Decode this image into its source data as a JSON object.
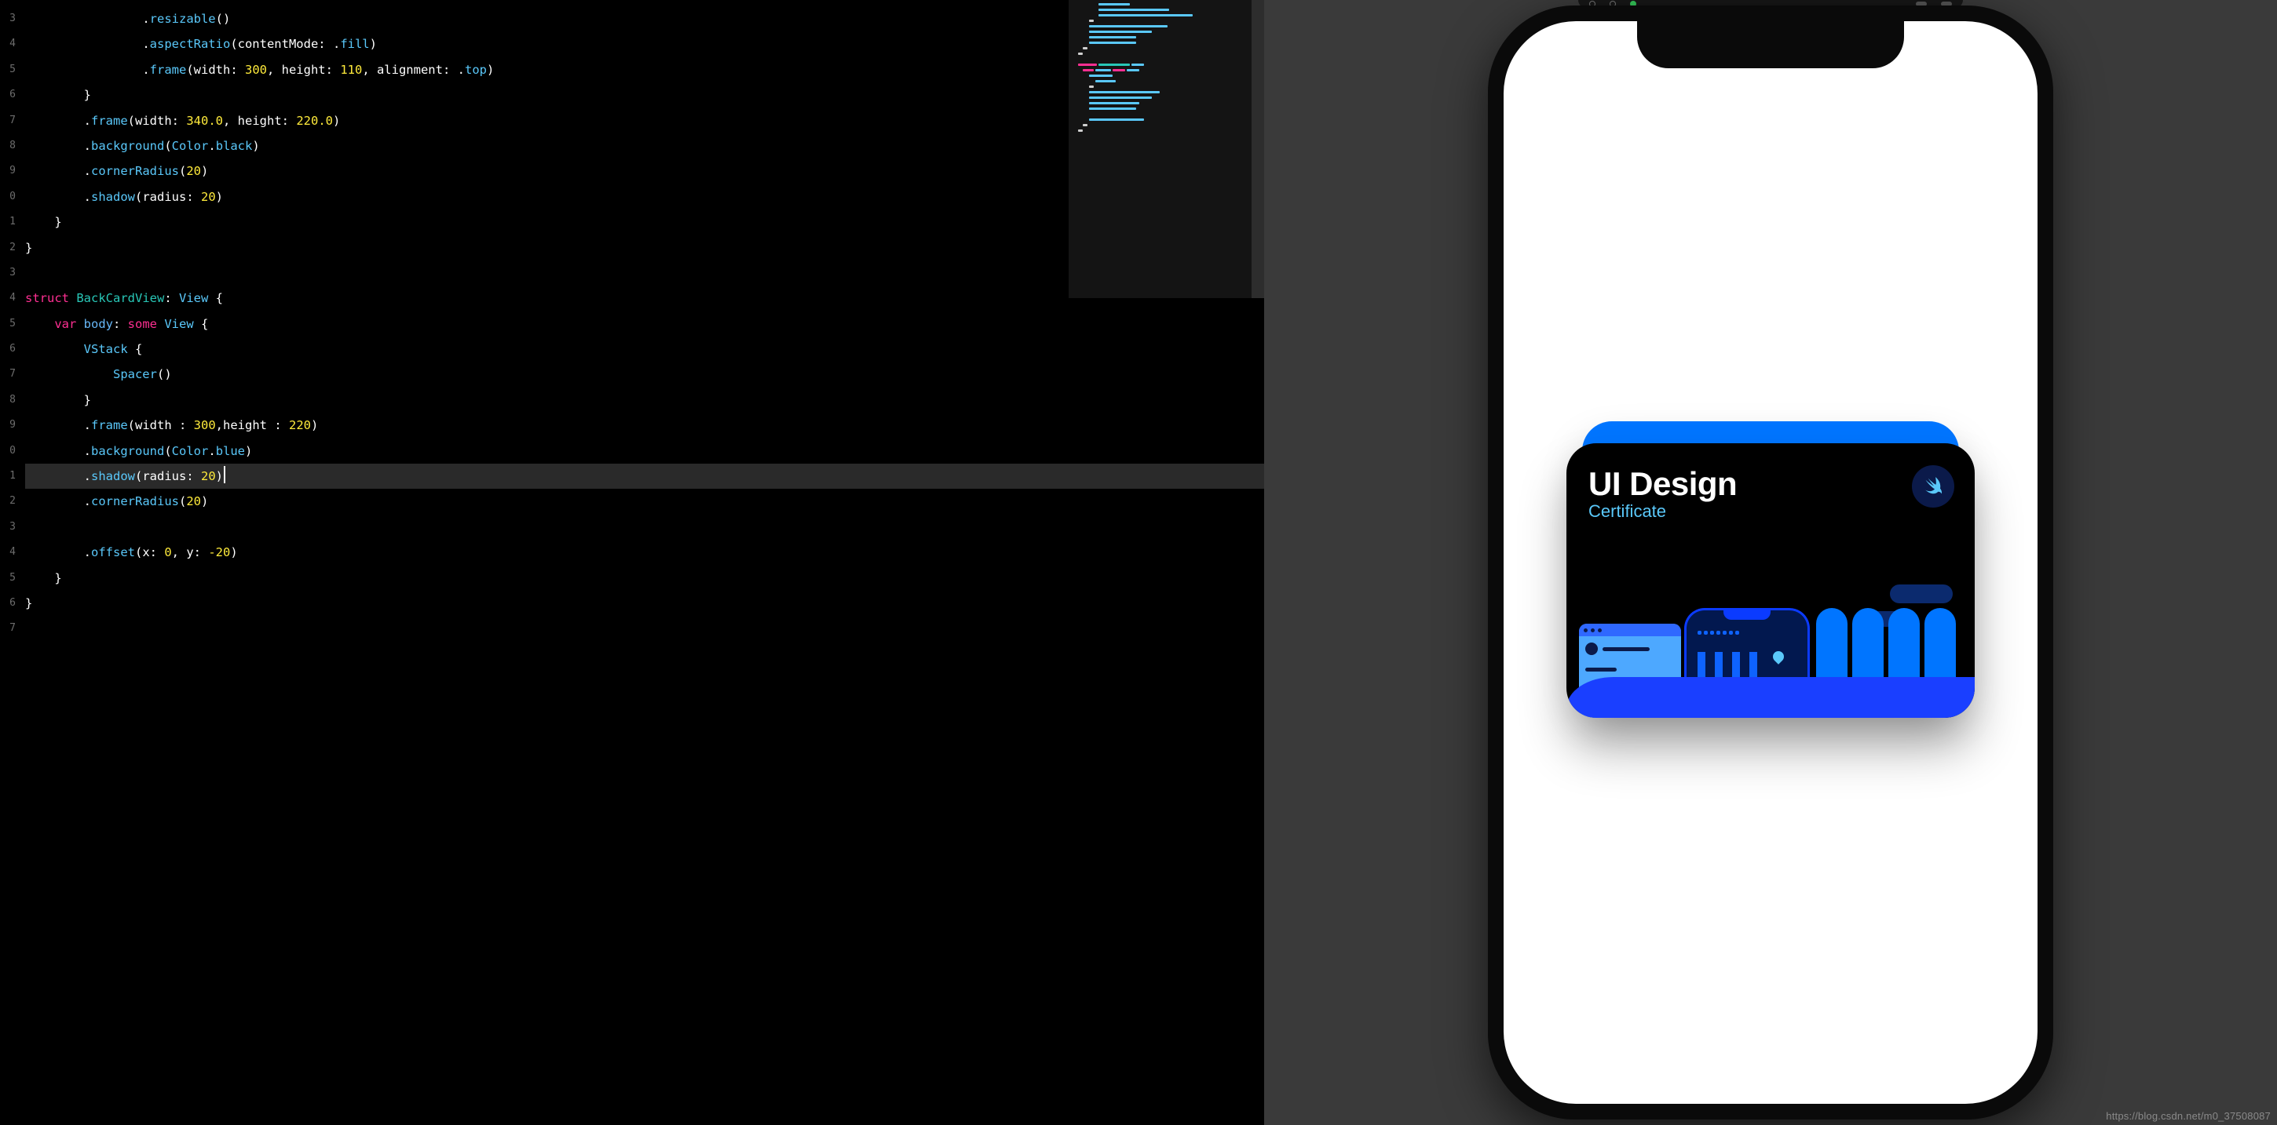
{
  "editor": {
    "gutter": [
      "3",
      "4",
      "5",
      "6",
      "7",
      "8",
      "9",
      "0",
      "1",
      "2",
      "3",
      "4",
      "5",
      "6",
      "7",
      "8",
      "9",
      "0",
      "1",
      "2",
      "3",
      "4",
      "5",
      "6",
      "7"
    ],
    "highlighted_line_index": 18,
    "cursor_line_index": 18,
    "lines": [
      {
        "indent": 16,
        "tokens": [
          {
            "t": ".",
            "c": "dot"
          },
          {
            "t": "resizable",
            "c": "func"
          },
          {
            "t": "()",
            "c": "plain"
          }
        ]
      },
      {
        "indent": 16,
        "tokens": [
          {
            "t": ".",
            "c": "dot"
          },
          {
            "t": "aspectRatio",
            "c": "func"
          },
          {
            "t": "(contentMode: ",
            "c": "plain"
          },
          {
            "t": ".",
            "c": "dot"
          },
          {
            "t": "fill",
            "c": "func"
          },
          {
            "t": ")",
            "c": "plain"
          }
        ]
      },
      {
        "indent": 16,
        "tokens": [
          {
            "t": ".",
            "c": "dot"
          },
          {
            "t": "frame",
            "c": "func"
          },
          {
            "t": "(width: ",
            "c": "plain"
          },
          {
            "t": "300",
            "c": "num"
          },
          {
            "t": ", height: ",
            "c": "plain"
          },
          {
            "t": "110",
            "c": "num"
          },
          {
            "t": ", alignment: ",
            "c": "plain"
          },
          {
            "t": ".",
            "c": "dot"
          },
          {
            "t": "top",
            "c": "func"
          },
          {
            "t": ")",
            "c": "plain"
          }
        ]
      },
      {
        "indent": 8,
        "tokens": [
          {
            "t": "}",
            "c": "plain"
          }
        ]
      },
      {
        "indent": 8,
        "tokens": [
          {
            "t": ".",
            "c": "dot"
          },
          {
            "t": "frame",
            "c": "func"
          },
          {
            "t": "(width: ",
            "c": "plain"
          },
          {
            "t": "340.0",
            "c": "num"
          },
          {
            "t": ", height: ",
            "c": "plain"
          },
          {
            "t": "220.0",
            "c": "num"
          },
          {
            "t": ")",
            "c": "plain"
          }
        ]
      },
      {
        "indent": 8,
        "tokens": [
          {
            "t": ".",
            "c": "dot"
          },
          {
            "t": "background",
            "c": "func"
          },
          {
            "t": "(",
            "c": "plain"
          },
          {
            "t": "Color",
            "c": "type"
          },
          {
            "t": ".",
            "c": "dot"
          },
          {
            "t": "black",
            "c": "func"
          },
          {
            "t": ")",
            "c": "plain"
          }
        ]
      },
      {
        "indent": 8,
        "tokens": [
          {
            "t": ".",
            "c": "dot"
          },
          {
            "t": "cornerRadius",
            "c": "func"
          },
          {
            "t": "(",
            "c": "plain"
          },
          {
            "t": "20",
            "c": "num"
          },
          {
            "t": ")",
            "c": "plain"
          }
        ]
      },
      {
        "indent": 8,
        "tokens": [
          {
            "t": ".",
            "c": "dot"
          },
          {
            "t": "shadow",
            "c": "func"
          },
          {
            "t": "(radius: ",
            "c": "plain"
          },
          {
            "t": "20",
            "c": "num"
          },
          {
            "t": ")",
            "c": "plain"
          }
        ]
      },
      {
        "indent": 4,
        "tokens": [
          {
            "t": "}",
            "c": "plain"
          }
        ]
      },
      {
        "indent": 0,
        "tokens": [
          {
            "t": "}",
            "c": "plain"
          }
        ]
      },
      {
        "indent": 0,
        "tokens": []
      },
      {
        "indent": 0,
        "tokens": [
          {
            "t": "struct ",
            "c": "kw"
          },
          {
            "t": "BackCardView",
            "c": "name"
          },
          {
            "t": ": ",
            "c": "plain"
          },
          {
            "t": "View",
            "c": "type"
          },
          {
            "t": " {",
            "c": "plain"
          }
        ]
      },
      {
        "indent": 4,
        "tokens": [
          {
            "t": "var ",
            "c": "kw"
          },
          {
            "t": "body",
            "c": "param"
          },
          {
            "t": ": ",
            "c": "plain"
          },
          {
            "t": "some ",
            "c": "kw"
          },
          {
            "t": "View",
            "c": "type"
          },
          {
            "t": " {",
            "c": "plain"
          }
        ]
      },
      {
        "indent": 8,
        "tokens": [
          {
            "t": "VStack",
            "c": "type"
          },
          {
            "t": " {",
            "c": "plain"
          }
        ]
      },
      {
        "indent": 12,
        "tokens": [
          {
            "t": "Spacer",
            "c": "type"
          },
          {
            "t": "()",
            "c": "plain"
          }
        ]
      },
      {
        "indent": 8,
        "tokens": [
          {
            "t": "}",
            "c": "plain"
          }
        ]
      },
      {
        "indent": 8,
        "tokens": [
          {
            "t": ".",
            "c": "dot"
          },
          {
            "t": "frame",
            "c": "func"
          },
          {
            "t": "(width : ",
            "c": "plain"
          },
          {
            "t": "300",
            "c": "num"
          },
          {
            "t": ",height : ",
            "c": "plain"
          },
          {
            "t": "220",
            "c": "num"
          },
          {
            "t": ")",
            "c": "plain"
          }
        ]
      },
      {
        "indent": 8,
        "tokens": [
          {
            "t": ".",
            "c": "dot"
          },
          {
            "t": "background",
            "c": "func"
          },
          {
            "t": "(",
            "c": "plain"
          },
          {
            "t": "Color",
            "c": "type"
          },
          {
            "t": ".",
            "c": "dot"
          },
          {
            "t": "blue",
            "c": "func"
          },
          {
            "t": ")",
            "c": "plain"
          }
        ]
      },
      {
        "indent": 8,
        "tokens": [
          {
            "t": ".",
            "c": "dot"
          },
          {
            "t": "shadow",
            "c": "func"
          },
          {
            "t": "(radius: ",
            "c": "plain"
          },
          {
            "t": "20",
            "c": "num"
          },
          {
            "t": ")",
            "c": "plain"
          }
        ]
      },
      {
        "indent": 8,
        "tokens": [
          {
            "t": ".",
            "c": "dot"
          },
          {
            "t": "cornerRadius",
            "c": "func"
          },
          {
            "t": "(",
            "c": "plain"
          },
          {
            "t": "20",
            "c": "num"
          },
          {
            "t": ")",
            "c": "plain"
          }
        ]
      },
      {
        "indent": 0,
        "tokens": []
      },
      {
        "indent": 8,
        "tokens": [
          {
            "t": ".",
            "c": "dot"
          },
          {
            "t": "offset",
            "c": "func"
          },
          {
            "t": "(x: ",
            "c": "plain"
          },
          {
            "t": "0",
            "c": "num"
          },
          {
            "t": ", y: ",
            "c": "plain"
          },
          {
            "t": "-20",
            "c": "num"
          },
          {
            "t": ")",
            "c": "plain"
          }
        ]
      },
      {
        "indent": 4,
        "tokens": [
          {
            "t": "}",
            "c": "plain"
          }
        ]
      },
      {
        "indent": 0,
        "tokens": [
          {
            "t": "}",
            "c": "plain"
          }
        ]
      },
      {
        "indent": 0,
        "tokens": []
      }
    ]
  },
  "preview": {
    "card": {
      "title": "UI Design",
      "subtitle": "Certificate"
    }
  },
  "watermark": "https://blog.csdn.net/m0_37508087"
}
